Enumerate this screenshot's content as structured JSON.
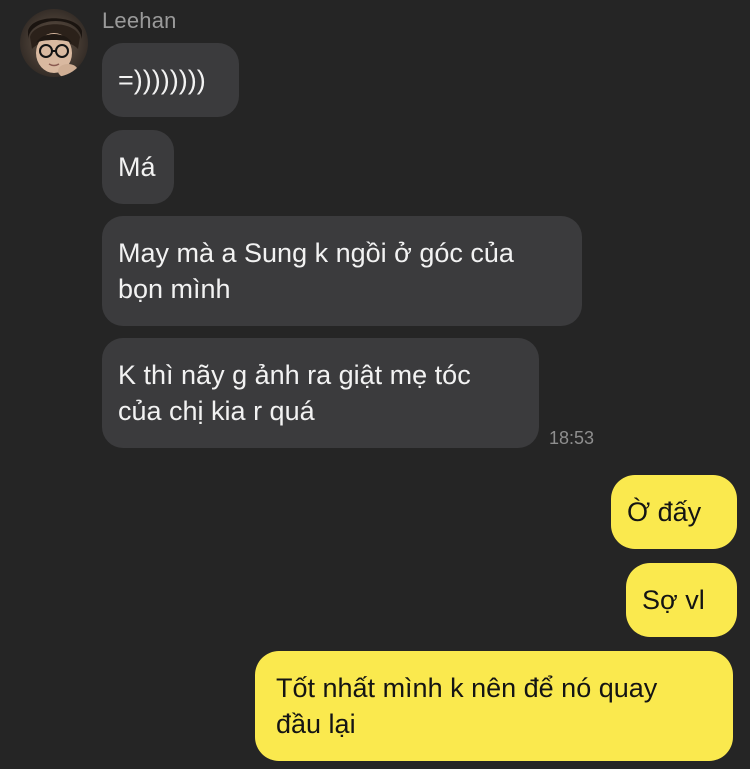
{
  "chat": {
    "sender_name": "Leehan",
    "incoming": [
      {
        "text": "=))))))))"
      },
      {
        "text": "Má"
      },
      {
        "text": "May mà a Sung k ngồi ở góc của\nbọn mình"
      },
      {
        "text": "K thì nãy g ảnh ra giật mẹ tóc\ncủa chị kia r quá"
      }
    ],
    "timestamp": "18:53",
    "outgoing": [
      {
        "text": "Ờ đấy"
      },
      {
        "text": "Sợ vl"
      },
      {
        "text": "Tốt nhất mình k nên để nó quay\nđầu lại"
      }
    ]
  },
  "colors": {
    "background": "#252525",
    "incoming_bubble": "#3b3b3d",
    "outgoing_bubble": "#fae94e",
    "sender_name": "#9a9a9a"
  },
  "icons": {
    "avatar": "avatar-photo"
  }
}
